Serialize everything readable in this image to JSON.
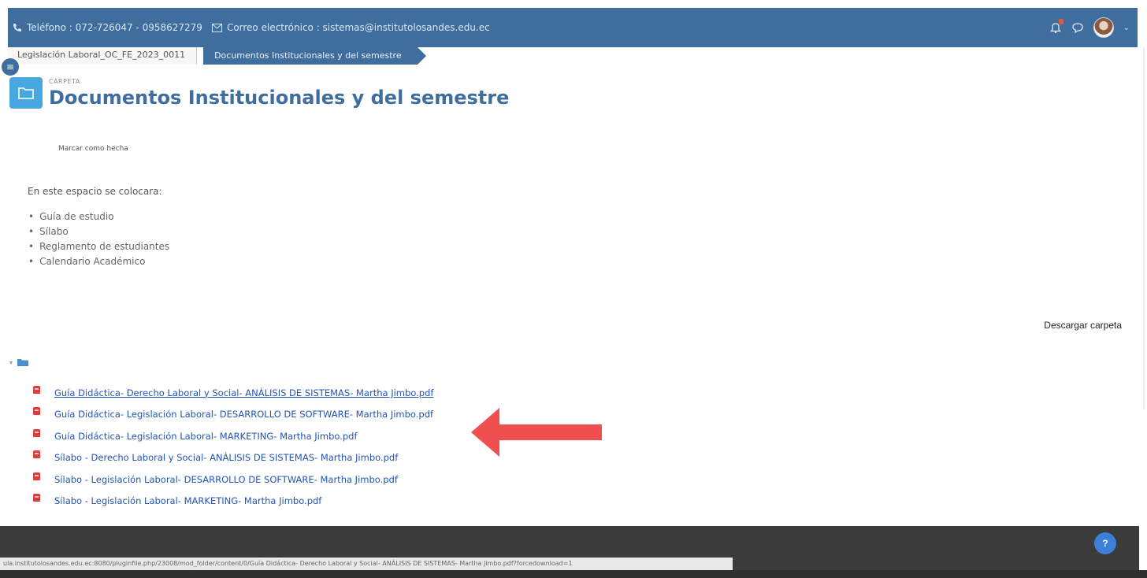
{
  "topbar": {
    "phone_text": "Teléfono : 072-726047 - 0958627279",
    "email_text": "Correo electrónico : sistemas@institutolosandes.edu.ec",
    "icons": [
      "phone-icon",
      "mail-icon",
      "bell-icon",
      "chat-icon",
      "avatar",
      "chevron-down-icon"
    ],
    "colors": {
      "bar": "#3f6e9e",
      "notification": "#e05b3a"
    }
  },
  "breadcrumb": {
    "course": "Legislación Laboral_OC_FE_2023_0011",
    "current": "Documentos Institucionales y del semestre"
  },
  "header": {
    "kicker": "CARPETA",
    "title": "Documentos Institucionales y del semestre",
    "icon": "folder-icon"
  },
  "mark_done_label": "Marcar como hecha",
  "intro_text": "En este espacio se colocara:",
  "items": [
    "Guía de estudio",
    "Sílabo",
    "Reglamento de estudiantes",
    "Calendario Académico"
  ],
  "download_label": "Descargar carpeta",
  "files": [
    "Guía Didáctica- Derecho Laboral y Social- ANÁLISIS DE SISTEMAS- Martha Jimbo.pdf",
    "Guía Didáctica- Legislación Laboral- DESARROLLO DE SOFTWARE- Martha Jimbo.pdf",
    "Guía Didáctica- Legislación Laboral- MARKETING- Martha Jimbo.pdf",
    "Sílabo - Derecho Laboral y Social- ANÁLISIS DE SISTEMAS- Martha Jimbo.pdf",
    "Sílabo - Legislación Laboral- DESARROLLO DE SOFTWARE- Martha Jimbo.pdf",
    "Sílabo - Legislación Laboral- MARKETING- Martha Jimbo.pdf"
  ],
  "help_label": "?",
  "status_url": "ula.institutolosandes.edu.ec:8080/pluginfile.php/23008/mod_folder/content/0/Guía Didáctica- Derecho Laboral y Social- ANÁLISIS DE SISTEMAS- Martha Jimbo.pdf?forcedownload=1",
  "colors": {
    "accent": "#3f6e9e",
    "link": "#2355b3",
    "folder": "#47a7e0",
    "pdf": "#e23b3b",
    "arrow": "#ef4f4f"
  }
}
